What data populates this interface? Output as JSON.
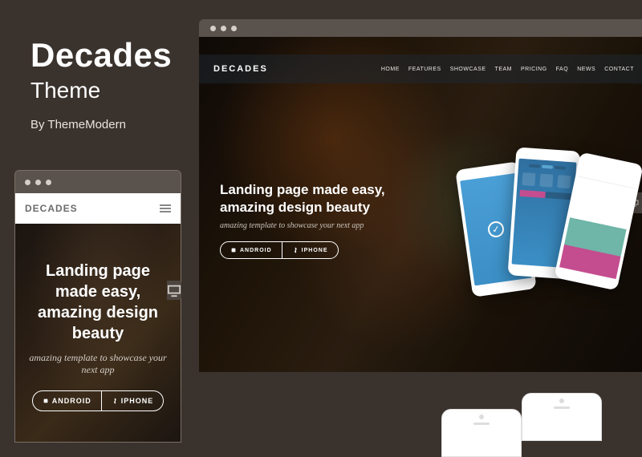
{
  "info": {
    "title": "Decades",
    "subtitle": "Theme",
    "author": "By ThemeModern"
  },
  "desktop": {
    "logo": "DECADES",
    "nav": [
      "HOME",
      "FEATURES",
      "SHOWCASE",
      "TEAM",
      "PRICING",
      "FAQ",
      "NEWS",
      "CONTACT"
    ],
    "headline1": "Landing page made easy,",
    "headline2": "amazing design beauty",
    "tagline": "amazing template to showcase your next app",
    "btn_android": "ANDROID",
    "btn_iphone": "IPHONE"
  },
  "mobile": {
    "logo": "DECADES",
    "headline": "Landing page made easy, amazing design beauty",
    "tagline": "amazing template to showcase your next app",
    "btn_android": "ANDROID",
    "btn_iphone": "IPHONE"
  },
  "colors": {
    "bg": "#3a322d",
    "phone_blue": "#4a9fd6",
    "accent_pink": "#c44d8f"
  }
}
